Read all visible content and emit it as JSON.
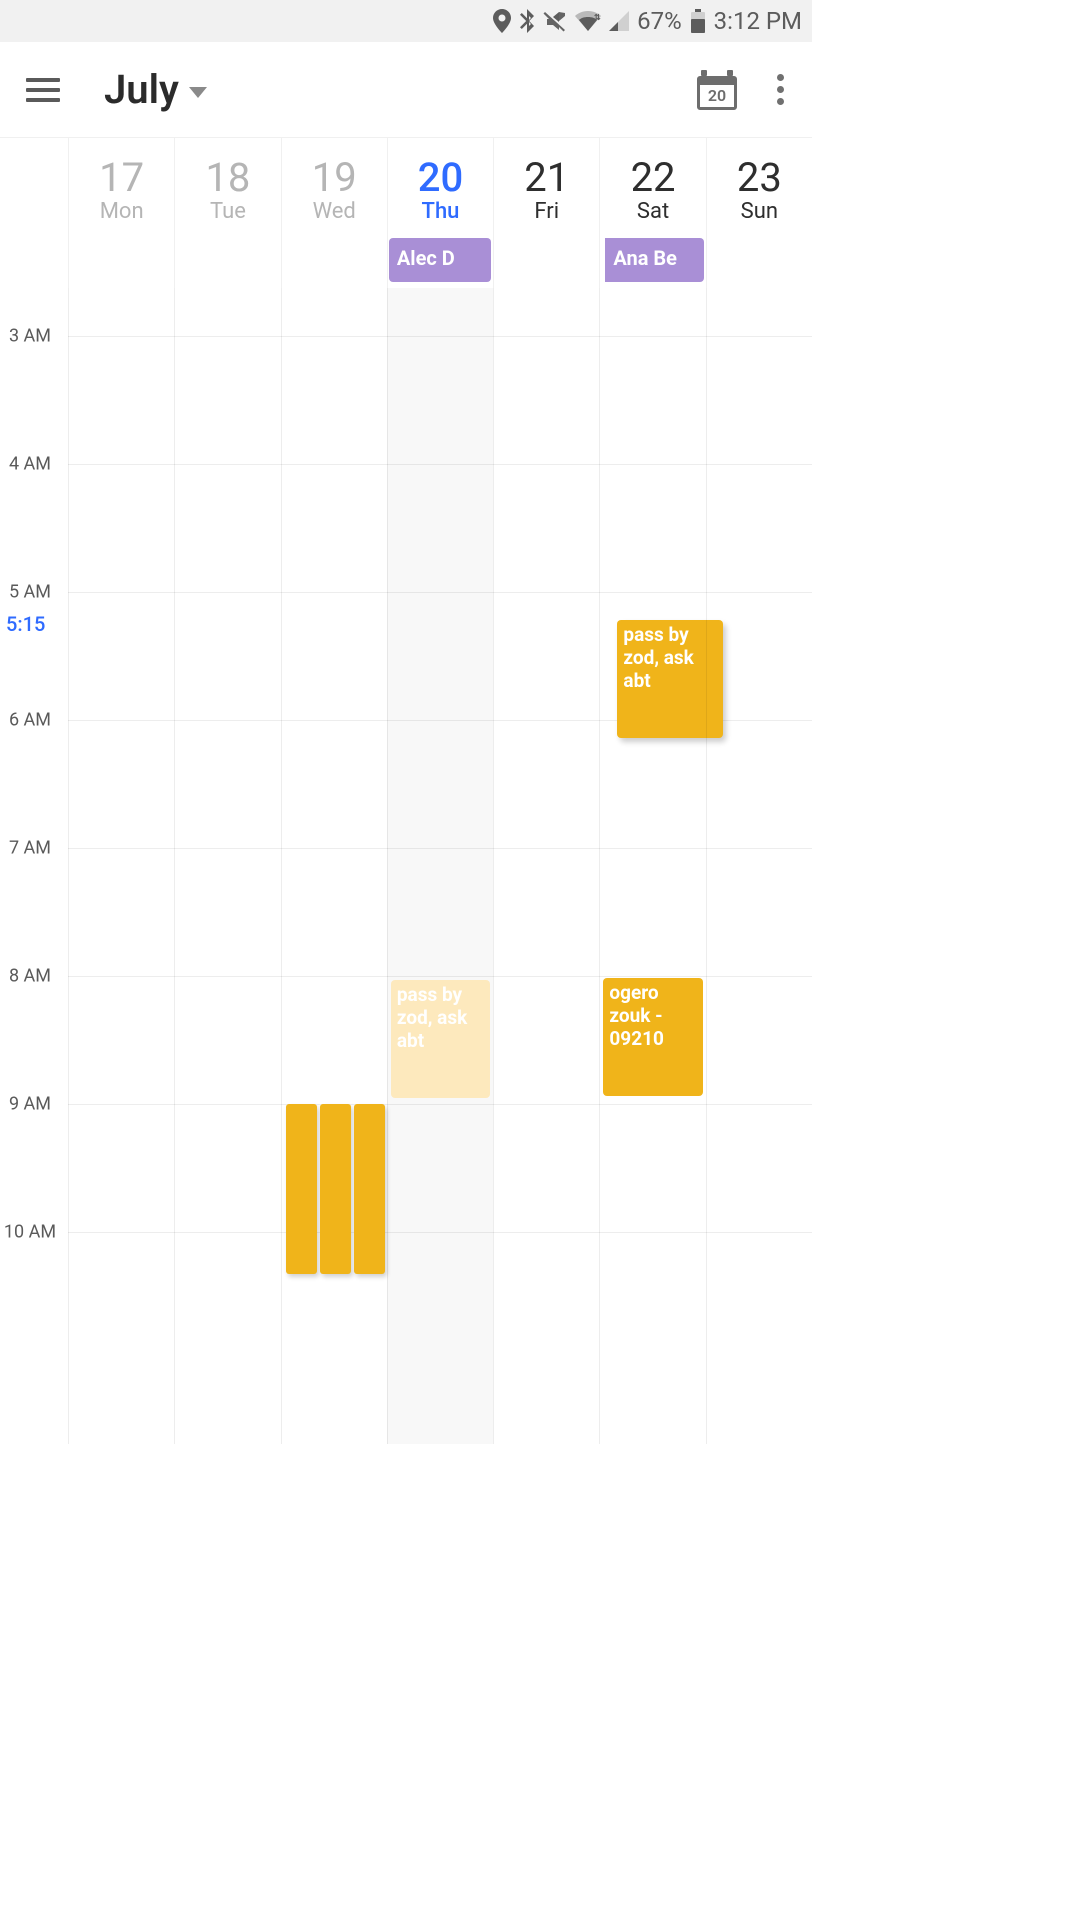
{
  "status": {
    "battery_pct": "67%",
    "clock": "3:12 PM"
  },
  "header": {
    "month": "July",
    "today_number": "20"
  },
  "days": [
    {
      "num": "17",
      "dow": "Mon",
      "cls": "past"
    },
    {
      "num": "18",
      "dow": "Tue",
      "cls": "past"
    },
    {
      "num": "19",
      "dow": "Wed",
      "cls": "past"
    },
    {
      "num": "20",
      "dow": "Thu",
      "cls": "today"
    },
    {
      "num": "21",
      "dow": "Fri",
      "cls": "future"
    },
    {
      "num": "22",
      "dow": "Sat",
      "cls": "future"
    },
    {
      "num": "23",
      "dow": "Sun",
      "cls": "future"
    }
  ],
  "allday": {
    "thu": "Alec D",
    "sat": "Ana Be"
  },
  "hours": {
    "h3": "3 AM",
    "h4": "4 AM",
    "h5": "5 AM",
    "h6": "6 AM",
    "h7": "7 AM",
    "h8": "8 AM",
    "h9": "9 AM",
    "h10": "10 AM"
  },
  "now_label": "5:15",
  "events": {
    "sat_early": "pass by zod, ask abt",
    "thu_faded": "pass by zod, ask abt",
    "sat_ogero": "ogero zouk - 09210"
  }
}
